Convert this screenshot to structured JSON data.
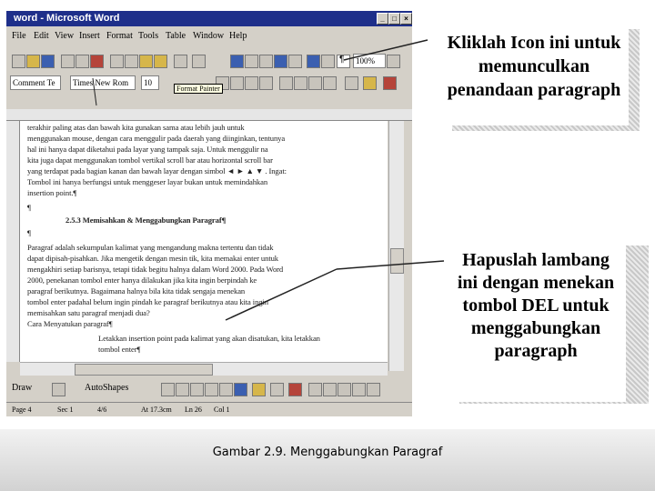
{
  "window": {
    "title": "word - Microsoft Word",
    "menu": [
      "File",
      "Edit",
      "View",
      "Insert",
      "Format",
      "Tools",
      "Table",
      "Window",
      "Help"
    ],
    "zoom": "100%",
    "style": "Comment Te",
    "font": "Times New Rom",
    "size": "10",
    "tooltip": "Format Painter"
  },
  "document": {
    "lines": [
      "terakhir paling atas dan bawah kita gunakan sama atau lebih jauh untuk",
      "menggunakan mouse, dengan cara menggulir pada daerah yang diinginkan, tentunya",
      "hal ini hanya dapat diketahui pada layar yang tampak saja. Untuk menggulir na",
      "kita juga dapat menggunakan tombol vertikal scroll bar atau horizontal scroll bar",
      "yang terdapat pada bagian kanan dan bawah layar dengan simbol ◄ ► ▲ ▼ . Ingat:",
      "Tombol ini hanya berfungsi untuk menggeser layar bukan untuk memindahkan",
      "insertion point.¶",
      "¶",
      "2.5.3 Memisahkan & Menggabungkan Paragraf¶",
      "¶",
      "Paragraf adalah sekumpulan kalimat yang mengandung makna tertentu dan tidak",
      "dapat dipisah-pisahkan. Jika mengetik dengan mesin tik, kita memakai enter untuk",
      "mengakhiri setiap barisnya, tetapi tidak begitu halnya dalam Word 2000. Pada Word",
      "2000, penekanan tombol enter hanya dilakukan jika kita ingin berpindah ke",
      "paragraf berikutnya. Bagaimana halnya bila kita tidak sengaja menekan",
      "tombol enter padahal belum ingin pindah ke paragraf berikutnya atau kita ingin",
      "memisahkan satu paragraf menjadi dua?",
      "Cara Menyatukan paragraf¶",
      "Letakkan insertion point pada kalimat yang akan disatukan, kita letakkan",
      "tombol enter¶"
    ]
  },
  "statusbar": [
    "Page 4",
    "Sec 1",
    "4/6",
    "At 17.3cm",
    "Ln 26",
    "Col 1"
  ],
  "drawbar": {
    "draw": "Draw",
    "autoshapes": "AutoShapes"
  },
  "callouts": {
    "top": [
      "Kliklah Icon  ini untuk",
      "memunculkan",
      "penandaan paragraph"
    ],
    "bottom": [
      "Hapuslah lambang",
      "ini dengan menekan",
      "tombol DEL untuk",
      "menggabungkan",
      "paragraph"
    ]
  },
  "caption": "Gambar 2.9. Menggabungkan Paragraf"
}
